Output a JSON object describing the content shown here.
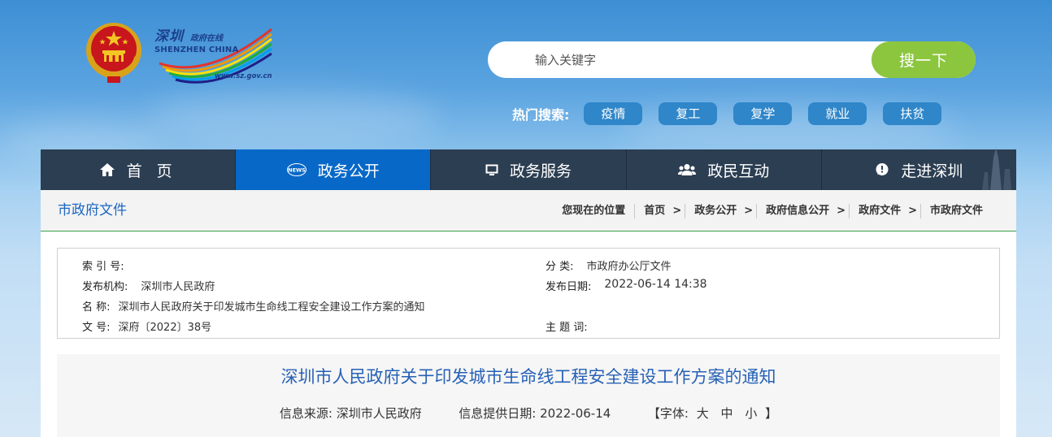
{
  "header": {
    "logo_cn": "深圳",
    "logo_cn_small": "政府在线",
    "logo_en": "SHENZHEN CHINA",
    "logo_url": "www.sz.gov.cn",
    "emblem_icon": "national-emblem-icon"
  },
  "search": {
    "placeholder": "输入关键字",
    "button_label": "搜一下"
  },
  "hot_search": {
    "label": "热门搜索:",
    "tags": [
      "疫情",
      "复工",
      "复学",
      "就业",
      "扶贫"
    ]
  },
  "nav": {
    "items": [
      {
        "label": "首 页",
        "icon": "home-icon"
      },
      {
        "label": "政务公开",
        "icon": "news-icon"
      },
      {
        "label": "政务服务",
        "icon": "monitor-icon"
      },
      {
        "label": "政民互动",
        "icon": "people-icon"
      },
      {
        "label": "走进深圳",
        "icon": "chat-bubble-icon"
      }
    ],
    "active_index": 1
  },
  "breadcrumb": {
    "section_title": "市政府文件",
    "location_label": "您现在的位置",
    "items": [
      "首页",
      "政务公开",
      "政府信息公开",
      "政府文件",
      "市政府文件"
    ],
    "separator": ">"
  },
  "meta": {
    "index_no_label": "索 引 号:",
    "index_no_value": "",
    "category_label": "分 类:",
    "category_value": "市政府办公厅文件",
    "publisher_label": "发布机构:",
    "publisher_value": "深圳市人民政府",
    "publish_date_label": "发布日期:",
    "publish_date_value": "2022-06-14 14:38",
    "name_label": "名 称:",
    "name_value": "深圳市人民政府关于印发城市生命线工程安全建设工作方案的通知",
    "doc_no_label": "文 号:",
    "doc_no_value": "深府〔2022〕38号",
    "subject_label": "主 题 词:",
    "subject_value": ""
  },
  "article": {
    "title": "深圳市人民政府关于印发城市生命线工程安全建设工作方案的通知",
    "source_label": "信息来源:",
    "source_value": "深圳市人民政府",
    "date_label": "信息提供日期:",
    "date_value": "2022-06-14",
    "font_open": "【字体:",
    "font_large": "大",
    "font_medium": "中",
    "font_small": "小",
    "font_close": "】"
  },
  "colors": {
    "nav_bg": "#2c3e52",
    "nav_active": "#0868c8",
    "search_button": "#8cc63f",
    "hot_tag": "#2f86c9",
    "title_blue": "#2761b6",
    "divider_green": "#3aa14a"
  }
}
